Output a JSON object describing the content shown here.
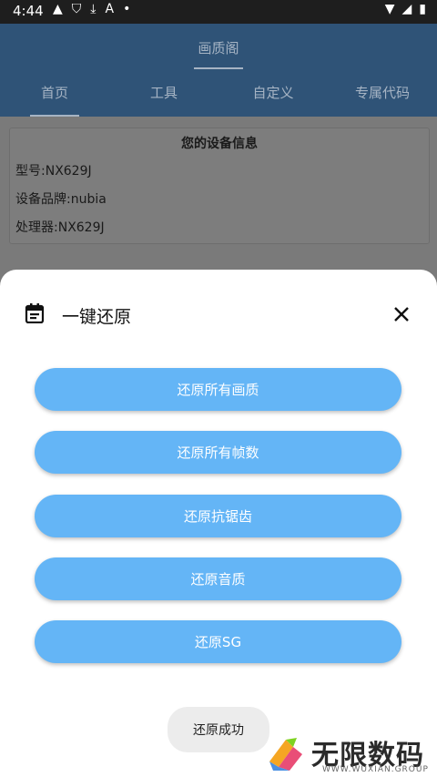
{
  "status": {
    "time": "4:44"
  },
  "app": {
    "title": "画质阁",
    "tabs": [
      "首页",
      "工具",
      "自定义",
      "专属代码"
    ]
  },
  "device_card": {
    "title": "您的设备信息",
    "rows": [
      "型号:NX629J",
      "设备品牌:nubia",
      "处理器:NX629J"
    ]
  },
  "sheet": {
    "title": "一键还原",
    "buttons": [
      "还原所有画质",
      "还原所有帧数",
      "还原抗锯齿",
      "还原音质",
      "还原SG"
    ]
  },
  "toast": "还原成功",
  "watermark": {
    "name": "无限数码",
    "sub": "WWW.WUXIAN.GROUP"
  },
  "colors": {
    "button": "#64b5f6",
    "header": "#2f5377"
  }
}
